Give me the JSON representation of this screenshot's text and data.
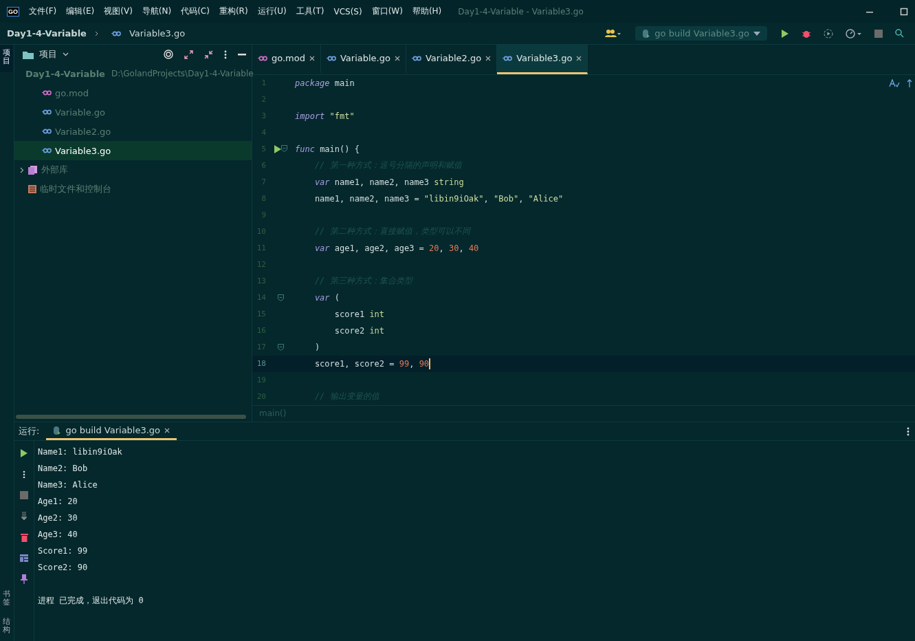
{
  "menu_bar": {
    "logo": "GO",
    "items": [
      "文件(F)",
      "编辑(E)",
      "视图(V)",
      "导航(N)",
      "代码(C)",
      "重构(R)",
      "运行(U)",
      "工具(T)",
      "VCS(S)",
      "窗口(W)",
      "帮助(H)"
    ],
    "title": "Day1-4-Variable - Variable3.go"
  },
  "nav_bar": {
    "breadcrumb": [
      "Day1-4-Variable",
      "Variable3.go"
    ],
    "run_config": "go build Variable3.go"
  },
  "left_strip_top": [
    {
      "label": "项目",
      "selected": true
    }
  ],
  "left_strip_bottom": [
    {
      "label": "书签",
      "selected": false
    },
    {
      "label": "结构",
      "selected": false
    }
  ],
  "project_panel": {
    "title": "项目",
    "tree": [
      {
        "label": "Day1-4-Variable",
        "path": "D:\\GolandProjects\\Day1-4-Variable",
        "kind": "folder",
        "expanded": true,
        "selected": false,
        "children": [
          {
            "label": "go.mod",
            "kind": "mod",
            "selected": false
          },
          {
            "label": "Variable.go",
            "kind": "go",
            "selected": false
          },
          {
            "label": "Variable2.go",
            "kind": "go",
            "selected": false
          },
          {
            "label": "Variable3.go",
            "kind": "go",
            "selected": true
          }
        ]
      },
      {
        "label": "外部库",
        "kind": "library",
        "expanded": false,
        "selected": false
      },
      {
        "label": "临时文件和控制台",
        "kind": "scratch",
        "selected": false
      }
    ]
  },
  "editor": {
    "tabs": [
      {
        "label": "go.mod",
        "kind": "mod",
        "selected": false
      },
      {
        "label": "Variable.go",
        "kind": "go",
        "selected": false
      },
      {
        "label": "Variable2.go",
        "kind": "go",
        "selected": false
      },
      {
        "label": "Variable3.go",
        "kind": "go",
        "selected": true
      }
    ],
    "lines": [
      {
        "number": "1",
        "current": false,
        "tokens": [
          {
            "kind": "kw",
            "text": "package"
          },
          {
            "kind": "plain",
            "text": " main"
          }
        ]
      },
      {
        "number": "2",
        "current": false
      },
      {
        "number": "3",
        "current": false,
        "tokens": [
          {
            "kind": "kw",
            "text": "import"
          },
          {
            "kind": "str",
            "text": " \"fmt\""
          }
        ]
      },
      {
        "number": "4",
        "current": false
      },
      {
        "number": "5",
        "current": false,
        "markers": [
          {
            "kind": "run"
          },
          {
            "kind": "fold"
          }
        ],
        "tokens": [
          {
            "kind": "kw",
            "text": "func"
          },
          {
            "kind": "plain",
            "text": " main() {"
          }
        ]
      },
      {
        "number": "6",
        "current": false,
        "tokens": [
          {
            "kind": "comment",
            "text": "    // 第一种方式：逗号分隔的声明和赋值"
          }
        ]
      },
      {
        "number": "7",
        "current": false,
        "tokens": [
          {
            "kind": "kw",
            "text": "    var"
          },
          {
            "kind": "plain",
            "text": " name1, name2, name3 "
          },
          {
            "kind": "type",
            "text": "string"
          }
        ]
      },
      {
        "number": "8",
        "current": false,
        "tokens": [
          {
            "kind": "plain",
            "text": "    name1, name2, name3 = "
          },
          {
            "kind": "str",
            "text": "\"libin9iOak\""
          },
          {
            "kind": "plain",
            "text": ", "
          },
          {
            "kind": "str",
            "text": "\"Bob\""
          },
          {
            "kind": "plain",
            "text": ", "
          },
          {
            "kind": "str",
            "text": "\"Alice\""
          }
        ]
      },
      {
        "number": "9",
        "current": false
      },
      {
        "number": "10",
        "current": false,
        "tokens": [
          {
            "kind": "comment",
            "text": "    // 第二种方式：直接赋值，类型可以不同"
          }
        ]
      },
      {
        "number": "11",
        "current": false,
        "tokens": [
          {
            "kind": "kw",
            "text": "    var"
          },
          {
            "kind": "plain",
            "text": " age1, age2, age3 = "
          },
          {
            "kind": "num",
            "text": "20"
          },
          {
            "kind": "plain",
            "text": ", "
          },
          {
            "kind": "num",
            "text": "30"
          },
          {
            "kind": "plain",
            "text": ", "
          },
          {
            "kind": "num",
            "text": "40"
          }
        ]
      },
      {
        "number": "12",
        "current": false
      },
      {
        "number": "13",
        "current": false,
        "tokens": [
          {
            "kind": "comment",
            "text": "    // 第三种方式：集合类型"
          }
        ]
      },
      {
        "number": "14",
        "current": false,
        "markers": [
          {
            "kind": "fold"
          }
        ],
        "tokens": [
          {
            "kind": "kw",
            "text": "    var"
          },
          {
            "kind": "plain",
            "text": " ("
          }
        ]
      },
      {
        "number": "15",
        "current": false,
        "tokens": [
          {
            "kind": "plain",
            "text": "        score1 "
          },
          {
            "kind": "type",
            "text": "int"
          }
        ]
      },
      {
        "number": "16",
        "current": false,
        "tokens": [
          {
            "kind": "plain",
            "text": "        score2 "
          },
          {
            "kind": "type",
            "text": "int"
          }
        ]
      },
      {
        "number": "17",
        "current": false,
        "markers": [
          {
            "kind": "fold"
          }
        ],
        "tokens": [
          {
            "kind": "plain",
            "text": "    )"
          }
        ]
      },
      {
        "number": "18",
        "current": true,
        "tokens": [
          {
            "kind": "plain",
            "text": "    score1, score2 = "
          },
          {
            "kind": "num",
            "text": "99"
          },
          {
            "kind": "plain",
            "text": ", "
          },
          {
            "kind": "num",
            "text": "90"
          }
        ]
      },
      {
        "number": "19",
        "current": false
      },
      {
        "number": "20",
        "current": false,
        "tokens": [
          {
            "kind": "comment",
            "text": "    // 输出变量的值"
          }
        ]
      }
    ],
    "breadcrumb": "main()"
  },
  "run_panel": {
    "label": "运行:",
    "tab": "go build Variable3.go",
    "output": [
      "Name1: libin9iOak",
      "Name2: Bob",
      "Name3: Alice",
      "Age1: 20",
      "Age2: 30",
      "Age3: 40",
      "Score1: 99",
      "Score2: 90"
    ],
    "exit_message": "进程 已完成，退出代码为 0"
  }
}
